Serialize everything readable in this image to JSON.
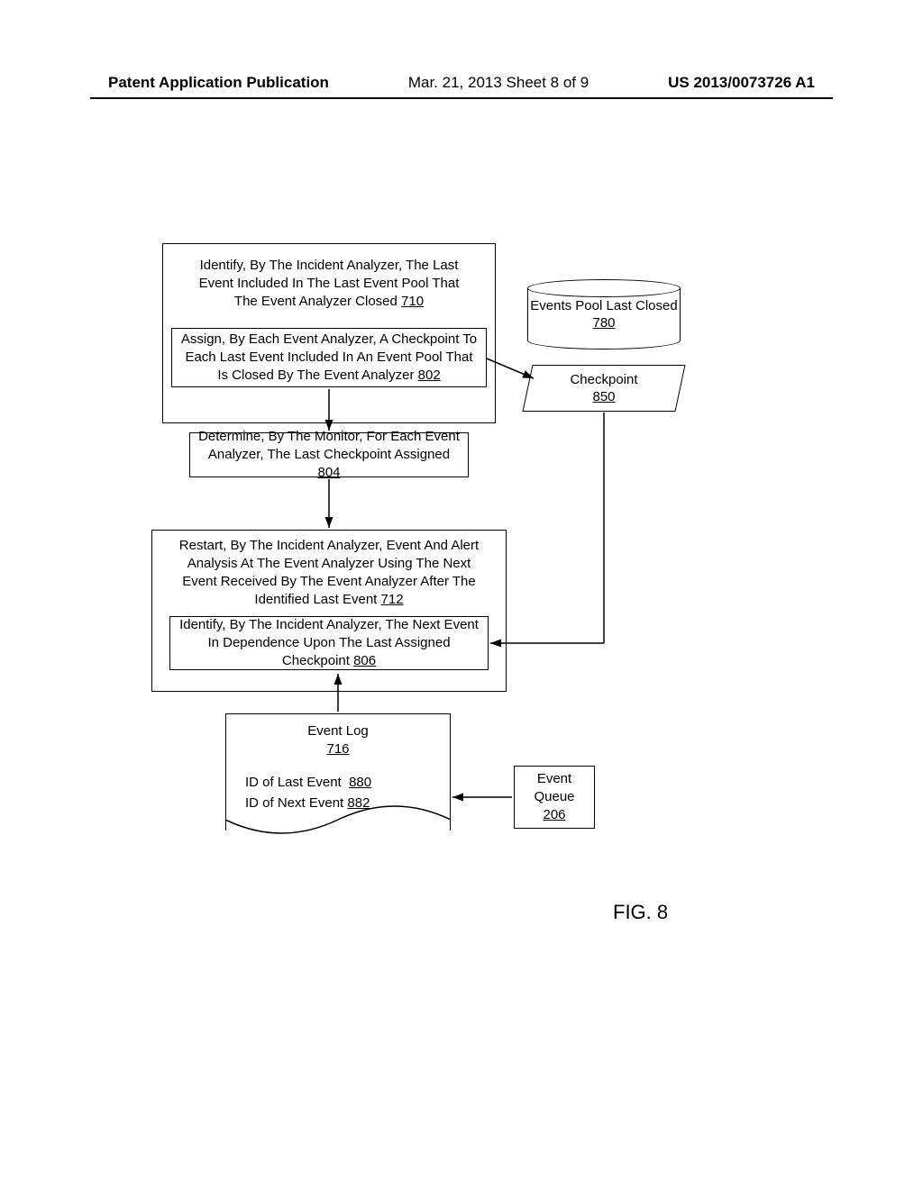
{
  "header": {
    "left": "Patent Application Publication",
    "center": "Mar. 21, 2013  Sheet 8 of 9",
    "right": "US 2013/0073726 A1"
  },
  "steps": {
    "s710": {
      "text": "Identify, By The Incident Analyzer, The Last Event Included In The Last Event Pool That The Event Analyzer Closed",
      "ref": "710"
    },
    "s802": {
      "text": "Assign, By Each Event Analyzer, A Checkpoint To Each Last Event Included In An Event Pool That Is Closed By The Event Analyzer",
      "ref": "802"
    },
    "s804": {
      "text": "Determine, By The Monitor, For Each Event Analyzer, The Last Checkpoint Assigned",
      "ref": "804"
    },
    "s712": {
      "text": "Restart, By The Incident Analyzer, Event And Alert Analysis At The Event Analyzer Using The Next Event Received By The Event Analyzer After The Identified Last Event",
      "ref": "712"
    },
    "s806": {
      "text": "Identify, By The Incident Analyzer, The Next Event In Dependence Upon The Last Assigned Checkpoint",
      "ref": "806"
    }
  },
  "data": {
    "pool": {
      "label": "Events Pool Last Closed",
      "ref": "780"
    },
    "checkpoint": {
      "label": "Checkpoint",
      "ref": "850"
    },
    "queue": {
      "label": "Event Queue",
      "ref": "206"
    }
  },
  "doc": {
    "title": "Event Log",
    "ref": "716",
    "line1": {
      "label": "ID of Last Event",
      "ref": "880"
    },
    "line2": {
      "label": "ID of Next Event",
      "ref": "882"
    }
  },
  "figure": "FIG. 8"
}
